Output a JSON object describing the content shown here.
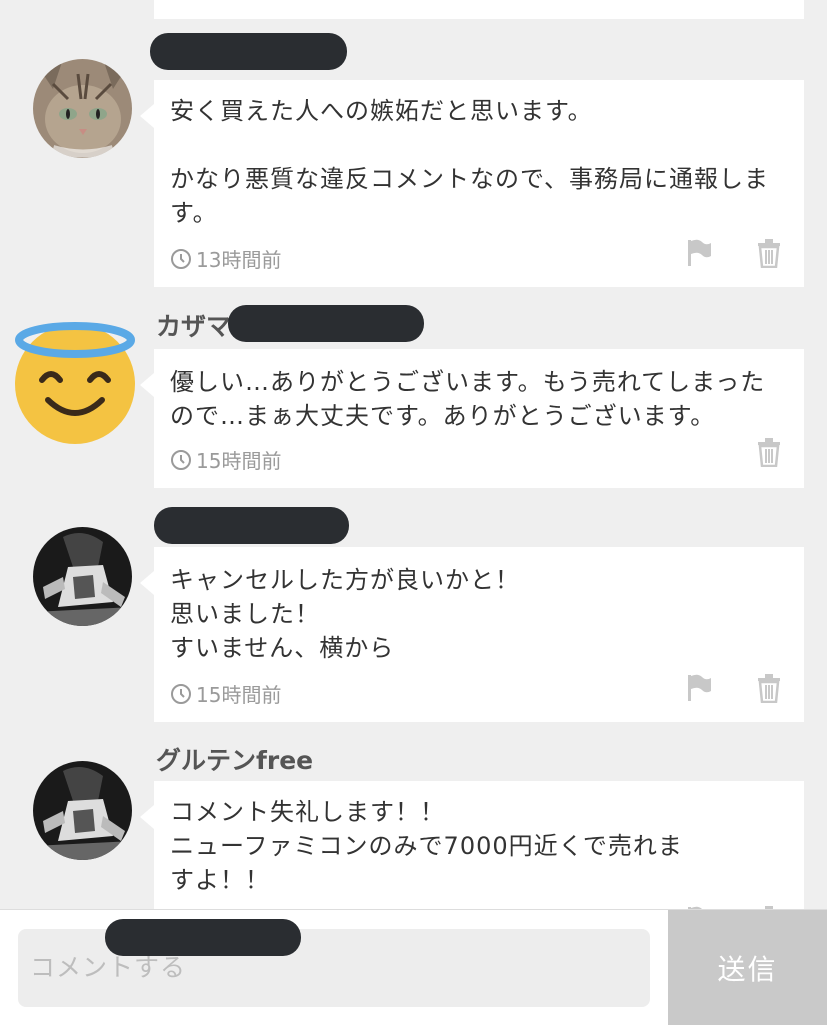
{
  "comments": [
    {
      "username": "",
      "text": "安く買えた人への嫉妬だと思います。\n\nかなり悪質な違反コメントなので、事務局に通報します。",
      "time": "13時間前",
      "avatar_icon": "cat-photo-avatar",
      "actions": [
        "flag-icon",
        "trash-icon"
      ]
    },
    {
      "username": "カザマ",
      "text": "優しい…ありがとうございます。もう売れてしまったので…まぁ大丈夫です。ありがとうございます。",
      "time": "15時間前",
      "avatar_icon": "smiling-face-with-halo-emoji",
      "actions": [
        "trash-icon"
      ]
    },
    {
      "username": "",
      "text": "キャンセルした方が良いかと！\n思いました！\nすいません、横から",
      "time": "15時間前",
      "avatar_icon": "monochrome-photo-avatar",
      "actions": [
        "flag-icon",
        "trash-icon"
      ]
    },
    {
      "username": "グルテンfree",
      "text": "コメント失礼します！！\nニューファミコンのみで7000円近くで売れますよ！！",
      "time": "",
      "avatar_icon": "monochrome-photo-avatar",
      "actions": [
        "flag-icon",
        "trash-icon"
      ]
    }
  ],
  "composer": {
    "placeholder": "コメントする",
    "send_label": "送信"
  },
  "colors": {
    "background": "#efefef",
    "bubble": "#ffffff",
    "redaction": "#2a2d31",
    "send_button": "#c9c9c9",
    "emoji_face": "#f4c342",
    "halo": "#5aa9e6"
  }
}
